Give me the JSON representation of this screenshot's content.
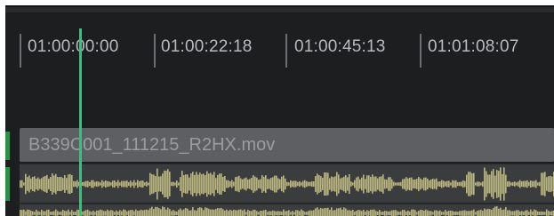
{
  "timeline": {
    "timecodes": [
      "01:00:00:00",
      "01:00:22:18",
      "01:00:45:13",
      "01:01:08:07"
    ]
  },
  "clip": {
    "name": "B339C001_111215_R2HX.mov"
  },
  "colors": {
    "panel_background": "#1d1e20",
    "clip_header": "#5e5f62",
    "audio_track": "#3b3c3e",
    "waveform": "#b8b58a",
    "playhead": "#19d07d",
    "track_edge": "#2f8f4a",
    "timecode_text": "#b8babd"
  }
}
